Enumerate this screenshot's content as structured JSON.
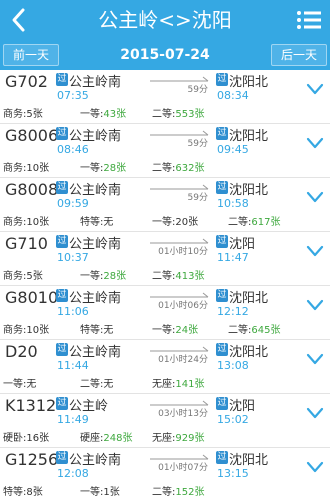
{
  "header": {
    "title": "公主岭<>沈阳"
  },
  "datebar": {
    "prev_label": "前一天",
    "date": "2015-07-24",
    "next_label": "后一天"
  },
  "colors": {
    "primary": "#35a8e3",
    "badge": "#2f8fd0",
    "available": "#3ea83e"
  },
  "trains": [
    {
      "no": "G702",
      "from_badge": "过",
      "from": "公主岭南",
      "dep": "07:35",
      "duration": "59分",
      "to_badge": "过",
      "to": "沈阳北",
      "arr": "08:34",
      "seats": [
        {
          "label": "商务:",
          "count": "5张",
          "green": false
        },
        {
          "label": "一等:",
          "count": "43张",
          "green": true
        },
        {
          "label": "二等:",
          "count": "553张",
          "green": true
        }
      ]
    },
    {
      "no": "G8006",
      "from_badge": "过",
      "from": "公主岭南",
      "dep": "08:46",
      "duration": "59分",
      "to_badge": "过",
      "to": "沈阳北",
      "arr": "09:45",
      "seats": [
        {
          "label": "商务:",
          "count": "10张",
          "green": false
        },
        {
          "label": "一等:",
          "count": "28张",
          "green": true
        },
        {
          "label": "二等:",
          "count": "632张",
          "green": true
        }
      ]
    },
    {
      "no": "G8008",
      "from_badge": "过",
      "from": "公主岭南",
      "dep": "09:59",
      "duration": "59分",
      "to_badge": "过",
      "to": "沈阳北",
      "arr": "10:58",
      "seats": [
        {
          "label": "商务:",
          "count": "10张",
          "green": false
        },
        {
          "label": "特等:",
          "count": "无",
          "green": false
        },
        {
          "label": "一等:",
          "count": "20张",
          "green": false
        },
        {
          "label": "二等:",
          "count": "617张",
          "green": true
        }
      ]
    },
    {
      "no": "G710",
      "from_badge": "过",
      "from": "公主岭南",
      "dep": "10:37",
      "duration": "01小时10分",
      "to_badge": "过",
      "to": "沈阳",
      "arr": "11:47",
      "seats": [
        {
          "label": "商务:",
          "count": "5张",
          "green": false
        },
        {
          "label": "一等:",
          "count": "28张",
          "green": true
        },
        {
          "label": "二等:",
          "count": "413张",
          "green": true
        }
      ]
    },
    {
      "no": "G8010",
      "from_badge": "过",
      "from": "公主岭南",
      "dep": "11:06",
      "duration": "01小时06分",
      "to_badge": "过",
      "to": "沈阳北",
      "arr": "12:12",
      "seats": [
        {
          "label": "商务:",
          "count": "10张",
          "green": false
        },
        {
          "label": "特等:",
          "count": "无",
          "green": false
        },
        {
          "label": "一等:",
          "count": "24张",
          "green": true
        },
        {
          "label": "二等:",
          "count": "645张",
          "green": true
        }
      ]
    },
    {
      "no": "D20",
      "from_badge": "过",
      "from": "公主岭南",
      "dep": "11:44",
      "duration": "01小时24分",
      "to_badge": "过",
      "to": "沈阳北",
      "arr": "13:08",
      "seats": [
        {
          "label": "一等:",
          "count": "无",
          "green": false
        },
        {
          "label": "二等:",
          "count": "无",
          "green": false
        },
        {
          "label": "无座:",
          "count": "141张",
          "green": true
        }
      ]
    },
    {
      "no": "K1312",
      "from_badge": "过",
      "from": "公主岭",
      "dep": "11:49",
      "duration": "03小时13分",
      "to_badge": "过",
      "to": "沈阳",
      "arr": "15:02",
      "seats": [
        {
          "label": "硬卧:",
          "count": "16张",
          "green": false
        },
        {
          "label": "硬座:",
          "count": "248张",
          "green": true
        },
        {
          "label": "无座:",
          "count": "929张",
          "green": true
        }
      ]
    },
    {
      "no": "G1256",
      "from_badge": "过",
      "from": "公主岭南",
      "dep": "12:08",
      "duration": "01小时07分",
      "to_badge": "过",
      "to": "沈阳北",
      "arr": "13:15",
      "seats": [
        {
          "label": "特等:",
          "count": "8张",
          "green": false
        },
        {
          "label": "一等:",
          "count": "1张",
          "green": false
        },
        {
          "label": "二等:",
          "count": "152张",
          "green": true
        }
      ]
    }
  ]
}
